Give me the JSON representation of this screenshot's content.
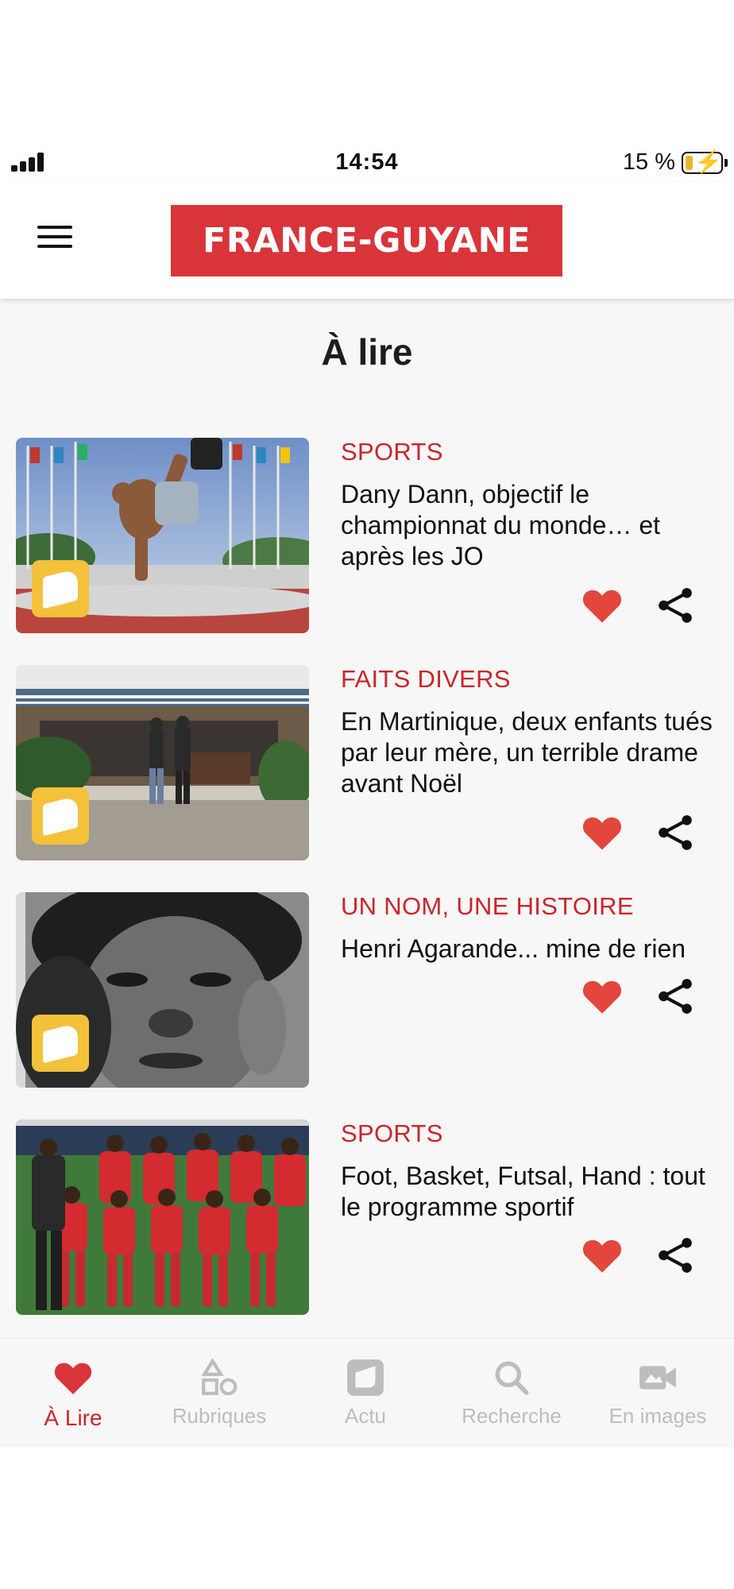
{
  "status_bar": {
    "time": "14:54",
    "battery": "15 %"
  },
  "header": {
    "logo_text": "FRANCE-GUYANE",
    "menu_icon": "hamburger-menu-icon"
  },
  "page": {
    "title": "À lire"
  },
  "articles": [
    {
      "category": "SPORTS",
      "title": "Dany Dann, objectif le championnat du monde… et après les JO",
      "image": "breakdancer-in-plaza-photo",
      "liked": true
    },
    {
      "category": "FAITS DIVERS",
      "title": "En Martinique, deux enfants tués par leur mère, un terrible drame avant Noël",
      "image": "police-at-building-photo",
      "liked": true
    },
    {
      "category": "UN NOM, UNE HISTOIRE",
      "title": "Henri Agarande... mine de rien",
      "image": "black-and-white-portrait-photo",
      "liked": true
    },
    {
      "category": "SPORTS",
      "title": "Foot, Basket, Futsal, Hand : tout le programme sportif",
      "image": "football-team-photo",
      "liked": true
    }
  ],
  "bottom_nav": {
    "items": [
      {
        "label": "À Lire",
        "icon": "heart-icon",
        "active": true
      },
      {
        "label": "Rubriques",
        "icon": "shapes-icon",
        "active": false
      },
      {
        "label": "Actu",
        "icon": "newspaper-icon",
        "active": false
      },
      {
        "label": "Recherche",
        "icon": "search-icon",
        "active": false
      },
      {
        "label": "En images",
        "icon": "video-camera-icon",
        "active": false
      }
    ]
  },
  "colors": {
    "brand_red": "#d9343a",
    "category_red": "#c8262c",
    "heart_red": "#e2463c",
    "badge_yellow": "#f3c13a",
    "inactive_gray": "#bdbdbd"
  }
}
